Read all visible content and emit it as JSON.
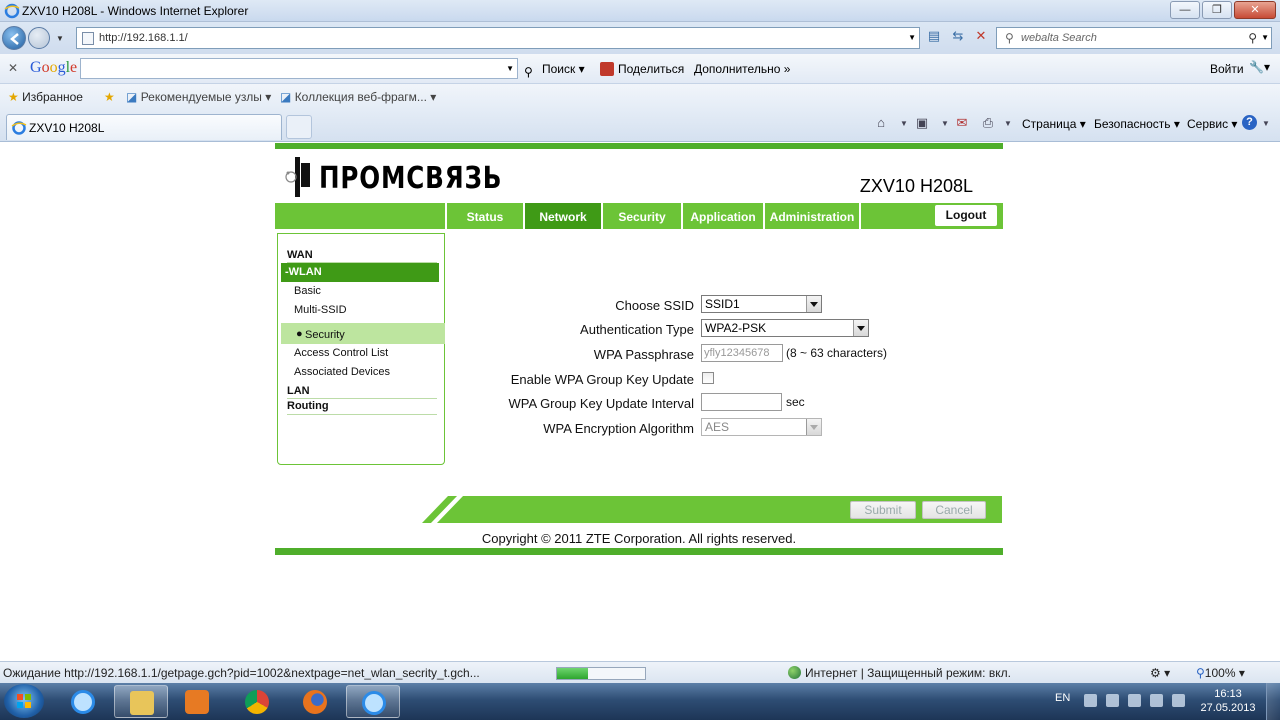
{
  "window": {
    "title": "ZXV10 H208L - Windows Internet Explorer",
    "address": "http://192.168.1.1/",
    "search_placeholder": "webalta Search"
  },
  "google_bar": {
    "logo": "Google",
    "search_label": "Поиск",
    "share_label": "Поделиться",
    "more_label": "Дополнительно »",
    "signin_label": "Войти"
  },
  "favorites_bar": {
    "favorites_label": "Избранное",
    "recommended_label": "Рекомендуемые узлы",
    "gallery_label": "Коллекция веб-фрагм..."
  },
  "tab": {
    "label": "ZXV10 H208L"
  },
  "command_bar": {
    "page_label": "Страница",
    "safety_label": "Безопасность",
    "tools_label": "Сервис"
  },
  "router": {
    "brand": "ПРОМСВЯЗЬ",
    "model": "ZXV10 H208L",
    "nav_tabs": [
      {
        "label": "Status",
        "active": false
      },
      {
        "label": "Network",
        "active": true
      },
      {
        "label": "Security",
        "active": false
      },
      {
        "label": "Application",
        "active": false
      },
      {
        "label": "Administration",
        "active": false
      }
    ],
    "logout_label": "Logout",
    "sidebar": {
      "wan": "WAN",
      "wlan": "-WLAN",
      "basic": "Basic",
      "multi_ssid": "Multi-SSID",
      "security": "Security",
      "acl": "Access Control List",
      "associated": "Associated Devices",
      "lan": "LAN",
      "routing": "Routing"
    },
    "form": {
      "ssid_label": "Choose SSID",
      "ssid_value": "SSID1",
      "auth_label": "Authentication Type",
      "auth_value": "WPA2-PSK",
      "passphrase_label": "WPA Passphrase",
      "passphrase_value": "yfly12345678",
      "passphrase_hint": "(8 ~ 63 characters)",
      "group_key_label": "Enable WPA Group Key Update",
      "group_key_checked": false,
      "interval_label": "WPA Group Key Update Interval",
      "interval_value": "",
      "interval_unit": "sec",
      "encryption_label": "WPA Encryption Algorithm",
      "encryption_value": "AES"
    },
    "submit_label": "Submit",
    "cancel_label": "Cancel",
    "copyright": "Copyright © 2011 ZTE Corporation. All rights reserved."
  },
  "status_bar": {
    "message": "Ожидание http://192.168.1.1/getpage.gch?pid=1002&nextpage=net_wlan_secrity_t.gch...",
    "zone": "Интернет | Защищенный режим: вкл.",
    "zoom": "100%",
    "progress": 0.35
  },
  "taskbar": {
    "lang": "EN",
    "time": "16:13",
    "date": "27.05.2013"
  }
}
